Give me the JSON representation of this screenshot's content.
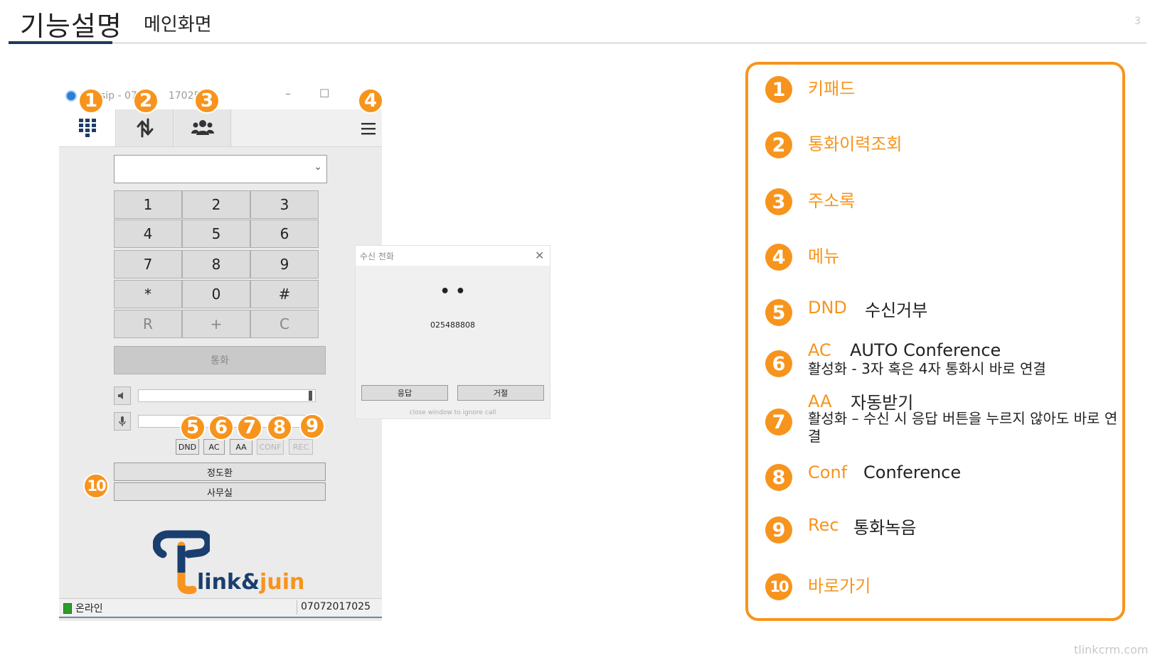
{
  "header": {
    "title": "기능설명",
    "subtitle": "메인화면",
    "page_number": "3"
  },
  "footer": {
    "site": "tlinkcrm.com"
  },
  "softphone": {
    "window_title_fragments": [
      "sip - 07",
      "17025"
    ],
    "window_buttons": {
      "minimize": "–",
      "maximize": "☐"
    },
    "tabs": [
      {
        "name": "keypad",
        "icon": "keypad-icon"
      },
      {
        "name": "history",
        "icon": "call-history-icon"
      },
      {
        "name": "contacts",
        "icon": "contacts-icon"
      }
    ],
    "menu_icon": "hamburger-icon",
    "dial_input": {
      "value": ""
    },
    "keypad": [
      [
        "1",
        "2",
        "3"
      ],
      [
        "4",
        "5",
        "6"
      ],
      [
        "7",
        "8",
        "9"
      ],
      [
        "*",
        "0",
        "#"
      ],
      [
        "R",
        "+",
        "C"
      ]
    ],
    "call_button": "통화",
    "feature_buttons": [
      "DND",
      "AC",
      "AA",
      "CONF",
      "REC"
    ],
    "quick_dial": [
      "정도환",
      "사무실"
    ],
    "status": {
      "text": "온라인",
      "number": "07072017025"
    },
    "logo": {
      "text_main": "link",
      "text_amp": "&",
      "text_accent": "juin"
    }
  },
  "incoming_popup": {
    "title": "수신 전화",
    "caller_name": "• •",
    "caller_number": "025488808",
    "answer_button": "응답",
    "reject_button": "거절",
    "hint": "close window to ignore call"
  },
  "badges": [
    "1",
    "2",
    "3",
    "4",
    "5",
    "6",
    "7",
    "8",
    "9",
    "10"
  ],
  "legend": [
    {
      "num": "1",
      "key": "키패드",
      "desc": ""
    },
    {
      "num": "2",
      "key": "통화이력조회",
      "desc": ""
    },
    {
      "num": "3",
      "key": "주소록",
      "desc": ""
    },
    {
      "num": "4",
      "key": "메뉴",
      "desc": ""
    },
    {
      "num": "5",
      "key": "DND",
      "desc": "수신거부"
    },
    {
      "num": "6",
      "key": "AC",
      "desc": "AUTO Conference",
      "sub": "활성화 - 3자 혹은 4자 통화시 바로 연결"
    },
    {
      "num": "7",
      "key": "AA",
      "desc": "자동받기",
      "sub": "활성화 – 수신 시 응답 버튼을 누르지 않아도 바로 연결"
    },
    {
      "num": "8",
      "key": "Conf",
      "desc": "Conference"
    },
    {
      "num": "9",
      "key": "Rec",
      "desc": "통화녹음"
    },
    {
      "num": "10",
      "key": "바로가기",
      "desc": ""
    }
  ],
  "colors": {
    "accent": "#f7941d",
    "brand_navy": "#1f3a5f",
    "online_led": "#2e9b2e"
  }
}
